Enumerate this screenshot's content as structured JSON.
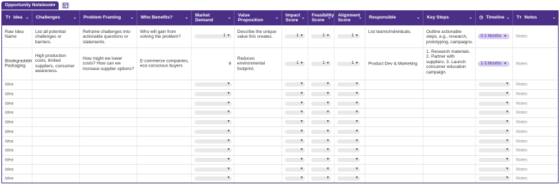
{
  "view": {
    "name": "Opportunity Notebook"
  },
  "columns": [
    {
      "key": "idea",
      "label": "Idea",
      "icon": "Tт"
    },
    {
      "key": "challenges",
      "label": "Challenges"
    },
    {
      "key": "framing",
      "label": "Problem Framing"
    },
    {
      "key": "benefits",
      "label": "Who Benefits?"
    },
    {
      "key": "demand",
      "label": "Market Demand"
    },
    {
      "key": "value",
      "label": "Value Proposition"
    },
    {
      "key": "impact",
      "label": "Impact Score"
    },
    {
      "key": "feasibility",
      "label": "Feasibility Score"
    },
    {
      "key": "alignment",
      "label": "Alignment Score"
    },
    {
      "key": "responsible",
      "label": "Responsible"
    },
    {
      "key": "steps",
      "label": "Key Steps"
    },
    {
      "key": "timeline",
      "label": "Timeline",
      "icon": "◷"
    },
    {
      "key": "notes",
      "label": "Notes",
      "icon": "Tт"
    }
  ],
  "rows": [
    {
      "idea": "Raw Idea Name",
      "challenges": "List all potential challenges or barriers.",
      "framing": "Reframe challenges into actionable questions or statements.",
      "benefits": "Who will gain from solving the problem?",
      "demand": "1",
      "value": "Describe the unique value this creates.",
      "impact": "1",
      "feasibility": "1",
      "alignment": "1",
      "responsible": "List teams/individuals.",
      "steps": "Outline actionable steps, e.g., research, prototyping, campaigns.",
      "timeline": "0-1 Months",
      "notes": "Notes"
    },
    {
      "idea": "Biodegradable Packaging",
      "challenges": "High production costs, limited suppliers, consumer awareness.",
      "framing": "How might we lower costs? How can we increase supplier options?",
      "benefits": "E-commerce companies, eco-conscious buyers",
      "demand": "9",
      "value": "Reduces environmental footprint.",
      "impact": "1",
      "feasibility": "1",
      "alignment": "1",
      "responsible": "Product Dev & Marketing",
      "steps": "1. Research materials. 2. Partner with suppliers. 3. Launch consumer education campaign.",
      "timeline": "1-3 Months",
      "notes": "Notes"
    }
  ],
  "empty_row": {
    "idea_placeholder": "Idea",
    "notes_placeholder": "Notes"
  },
  "colors": {
    "header": "#4a2f87",
    "pill": "#d9cdf4"
  }
}
